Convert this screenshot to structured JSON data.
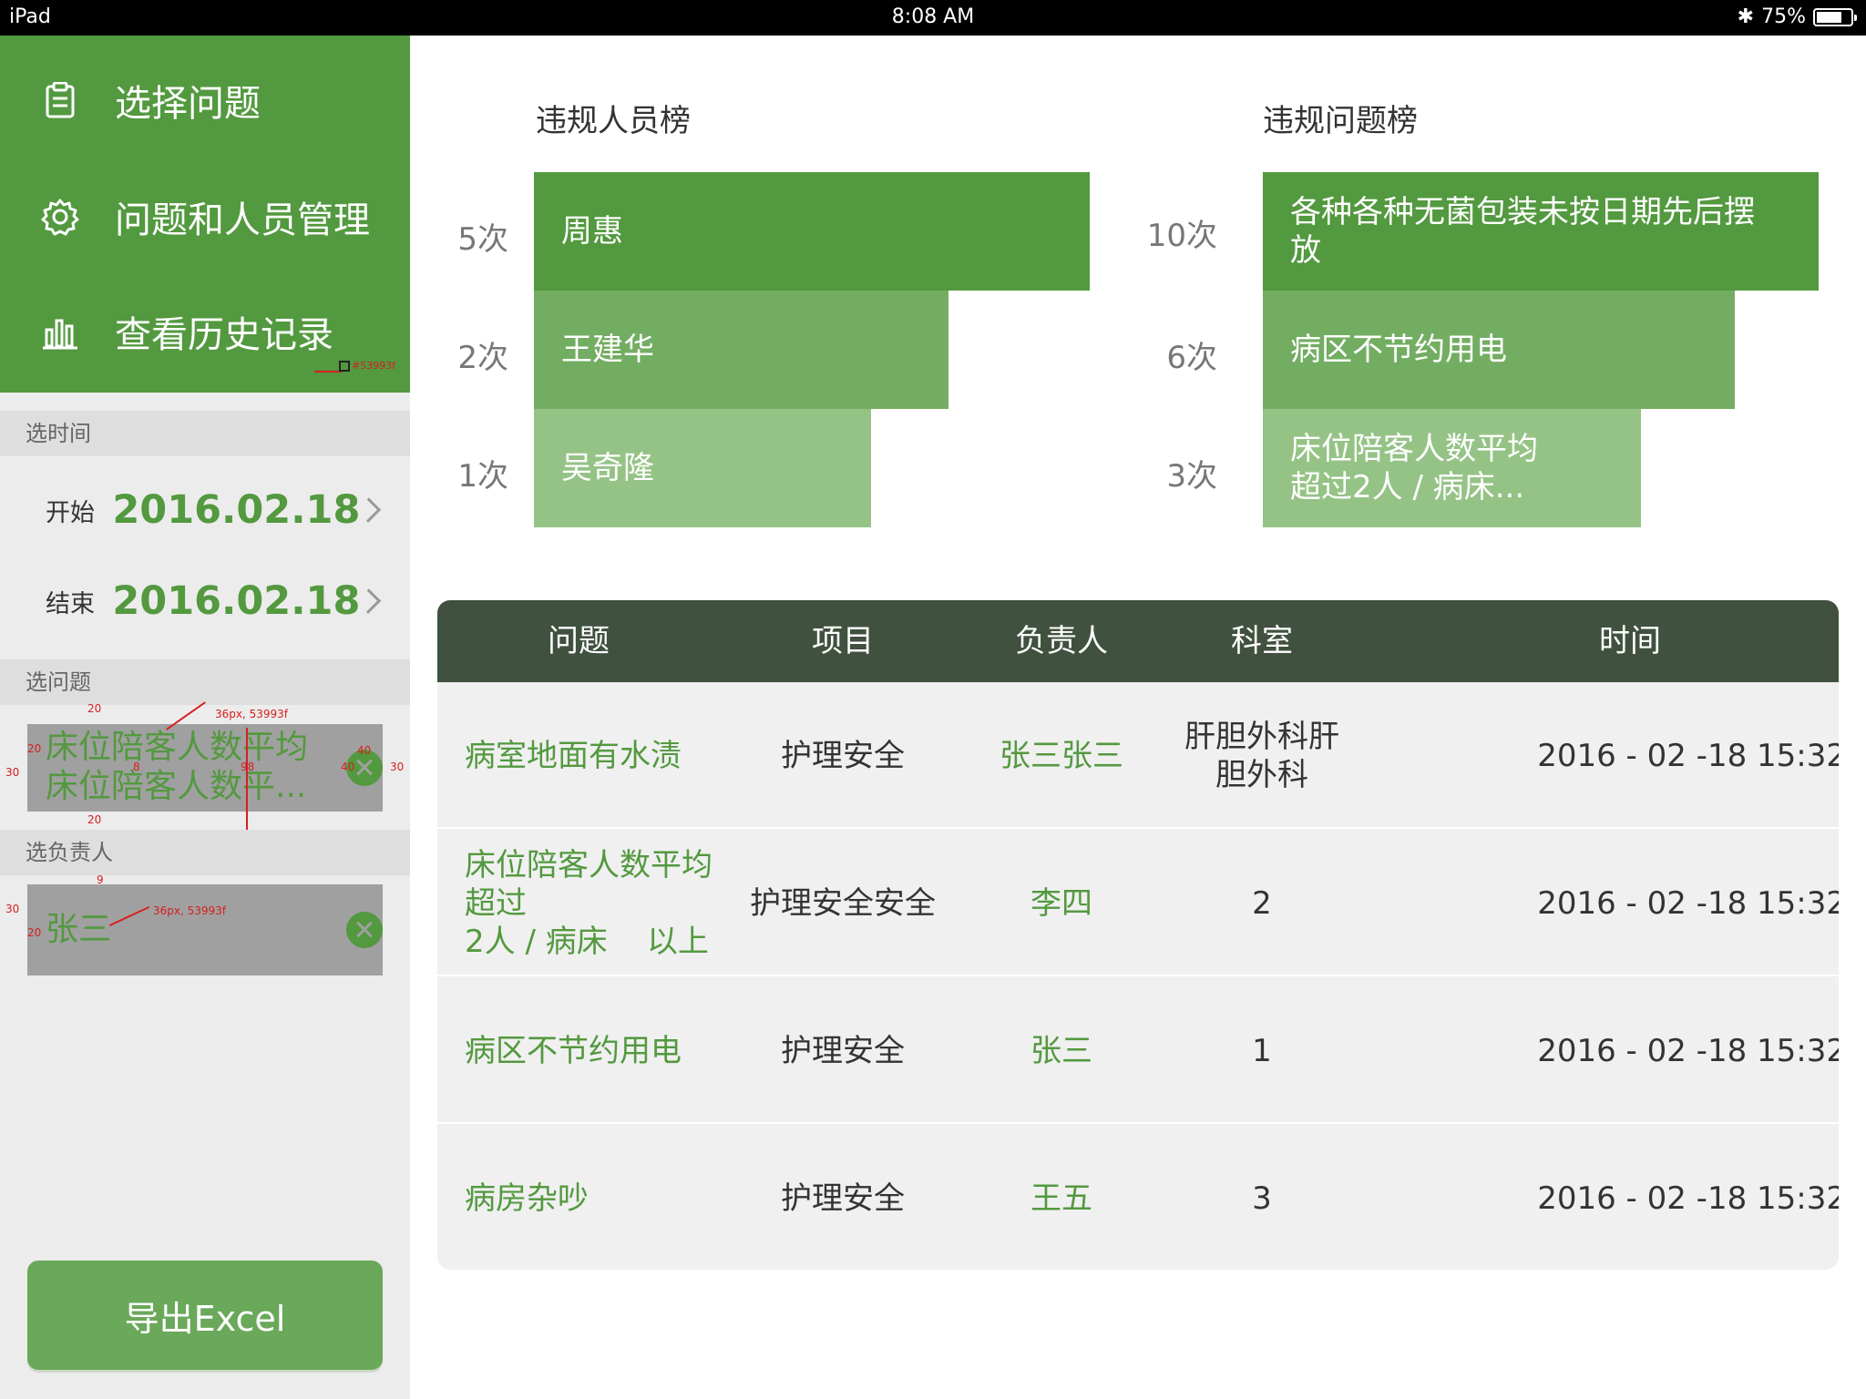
{
  "status_bar": {
    "device": "iPad",
    "time": "8:08 AM",
    "battery": "75%",
    "battery_level": 0.75
  },
  "sidebar": {
    "menu": [
      {
        "label": "选择问题",
        "icon": "clipboard-icon"
      },
      {
        "label": "问题和人员管理",
        "icon": "gear-icon"
      },
      {
        "label": "查看历史记录",
        "icon": "bar-chart-icon"
      }
    ],
    "menu_annotation": "#53993f",
    "time_section": "选时间",
    "start": {
      "label": "开始",
      "value": "2016.02.18"
    },
    "end": {
      "label": "结束",
      "value": "2016.02.18"
    },
    "problem_section": "选问题",
    "problem_selected": {
      "line1": "床位陪客人数平均",
      "line2": "床位陪客人数平..."
    },
    "person_section": "选负责人",
    "person_selected": "张三",
    "annotations": {
      "font_note": "36px, 53993f",
      "n20": "20",
      "n30": "30",
      "n40": "40",
      "n8": "8",
      "n98": "98",
      "n9": "9"
    },
    "export_label": "导出Excel"
  },
  "rankings": {
    "people": {
      "title": "违规人员榜",
      "items": [
        {
          "name": "周惠",
          "count": "5次",
          "value": 5
        },
        {
          "name": "王建华",
          "count": "2次",
          "value": 2
        },
        {
          "name": "吴奇隆",
          "count": "1次",
          "value": 1
        }
      ]
    },
    "problems": {
      "title": "违规问题榜",
      "items": [
        {
          "name1": "各种各种无菌包装未按日期先后摆",
          "name2": "放",
          "count": "10次",
          "value": 10
        },
        {
          "name1": "病区不节约用电",
          "name2": "",
          "count": "6次",
          "value": 6
        },
        {
          "name1": "床位陪客人数平均",
          "name2": "超过2人 / 病床...",
          "count": "3次",
          "value": 3
        }
      ]
    }
  },
  "table": {
    "headers": [
      "问题",
      "项目",
      "负责人",
      "科室",
      "时间"
    ],
    "rows": [
      {
        "problem1": "病室地面有水渍",
        "problem2": "",
        "project": "护理安全",
        "person": "张三张三",
        "dept1": "肝胆外科肝",
        "dept2": "胆外科",
        "time": "2016 - 02 -18   15:32"
      },
      {
        "problem1": "床位陪客人数平均超过",
        "problem2": "2人 / 病床    以上",
        "project": "护理安全安全",
        "person": "李四",
        "dept1": "2",
        "dept2": "",
        "time": "2016 - 02 -18   15:32"
      },
      {
        "problem1": "病区不节约用电",
        "problem2": "",
        "project": "护理安全",
        "person": "张三",
        "dept1": "1",
        "dept2": "",
        "time": "2016 - 02 -18   15:32"
      },
      {
        "problem1": "病房杂吵",
        "problem2": "",
        "project": "护理安全",
        "person": "王五",
        "dept1": "3",
        "dept2": "",
        "time": "2016 - 02 -18   15:32"
      }
    ]
  },
  "colors": {
    "brand": "#53993f",
    "bar_1": "#53993f",
    "bar_2": "#73ad62",
    "bar_3": "#95c386",
    "table_header": "#40513f"
  }
}
